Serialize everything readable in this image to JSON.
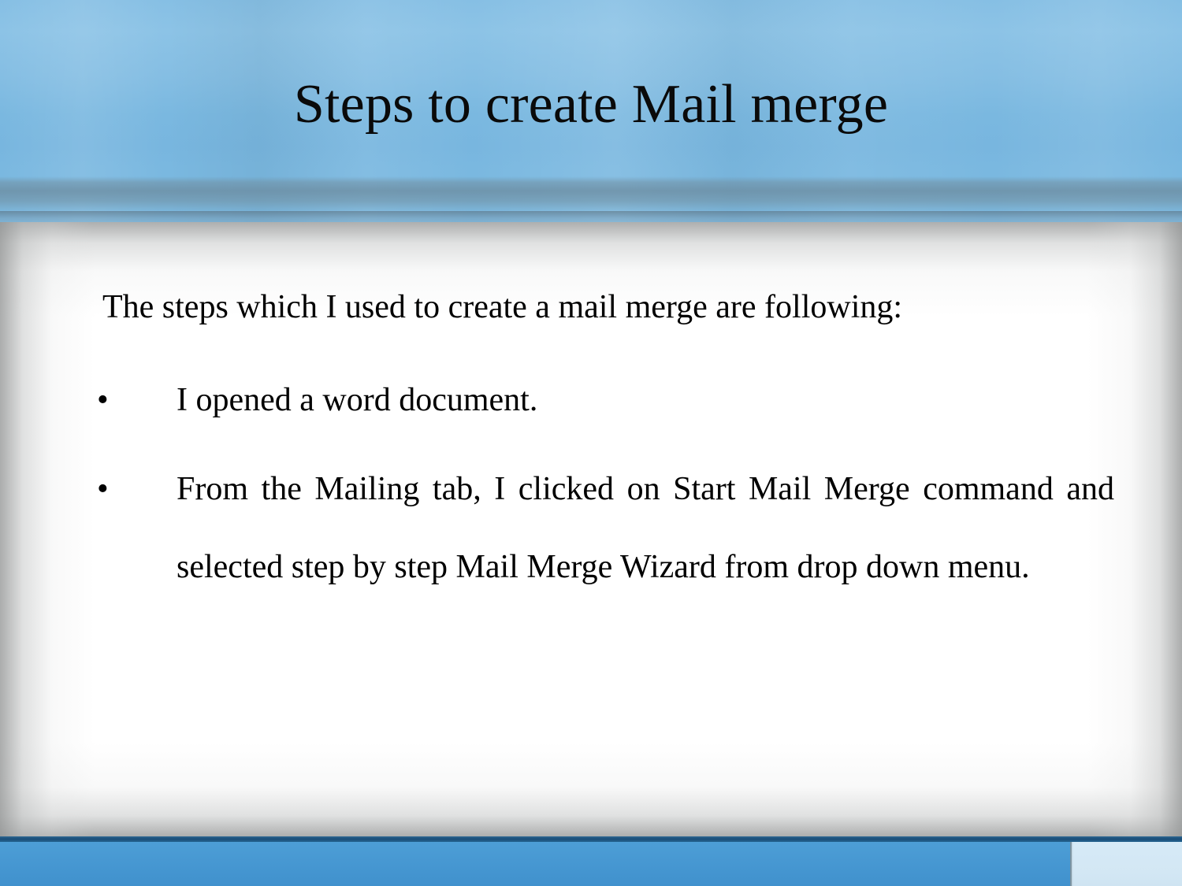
{
  "slide": {
    "title": "Steps to create Mail merge",
    "lead_paragraph": "The steps which I used to create a mail merge are following:",
    "bullets": [
      {
        "marker": "•",
        "text": "I opened a word document."
      },
      {
        "marker": "•",
        "text": "From the Mailing tab, I clicked on Start Mail Merge command and selected step by step Mail Merge Wizard from drop down menu."
      }
    ]
  },
  "theme": {
    "header_blue": "#7ab8e0",
    "header_band_blue": "#6c8ca0",
    "footer_blue": "#4798d2",
    "footer_topline_navy": "#1a4d78",
    "footer_accent_light_blue": "#d3e7f4",
    "text_black": "#000000",
    "content_white": "#ffffff"
  }
}
